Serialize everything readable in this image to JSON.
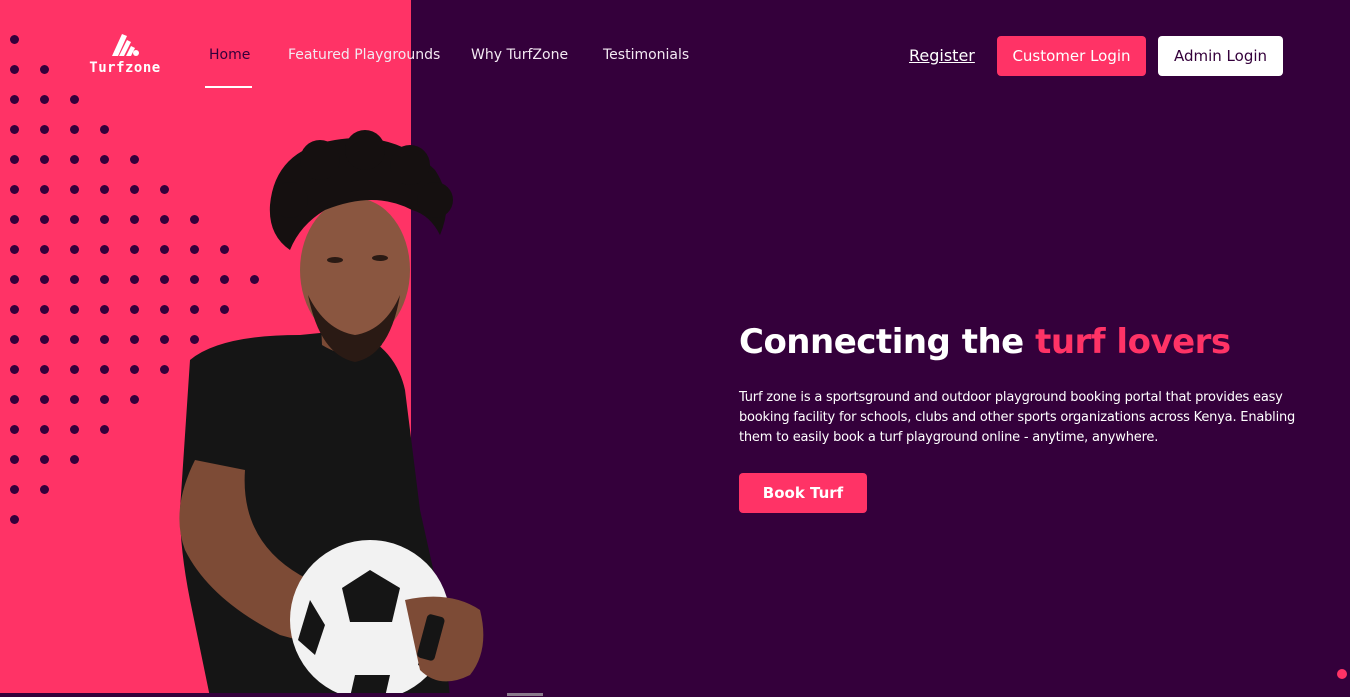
{
  "brand": {
    "name": "Turfzone",
    "logo_icon": "turfzone-logo-icon"
  },
  "nav": {
    "items": [
      {
        "label": "Home",
        "active": true
      },
      {
        "label": "Featured Playgrounds",
        "active": false
      },
      {
        "label": "Why TurfZone",
        "active": false
      },
      {
        "label": "Testimonials",
        "active": false
      }
    ]
  },
  "auth": {
    "register": "Register",
    "customer_login": "Customer Login",
    "admin_login": "Admin Login"
  },
  "hero": {
    "title_main": "Connecting the ",
    "title_accent": "turf lovers",
    "description": "Turf zone is a sportsground and outdoor playground booking portal that provides easy booking facility for schools, clubs and other sports organizations across Kenya. Enabling them to easily book a turf playground online - anytime, anywhere.",
    "cta": "Book Turf"
  },
  "colors": {
    "accent": "#ff3366",
    "background": "#34003b",
    "white": "#ffffff"
  }
}
